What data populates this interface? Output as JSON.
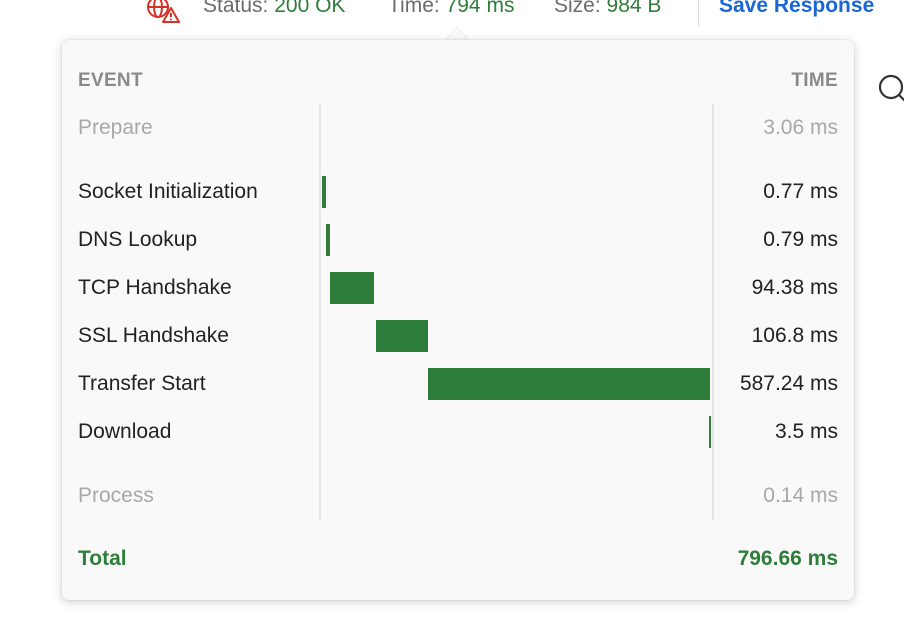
{
  "topbar": {
    "status_label": "Status:",
    "status_value": "200 OK",
    "time_label": "Time:",
    "time_value": "794 ms",
    "size_label": "Size:",
    "size_value": "984 B",
    "save_label": "Save Response",
    "network_icon": "globe-warning-icon",
    "search_icon": "search-icon"
  },
  "timing": {
    "header_event": "EVENT",
    "header_time": "TIME",
    "prepare": {
      "label": "Prepare",
      "value": "3.06 ms"
    },
    "events": [
      {
        "label": "Socket Initialization",
        "value": "0.77 ms",
        "ms": 0.77
      },
      {
        "label": "DNS Lookup",
        "value": "0.79 ms",
        "ms": 0.79
      },
      {
        "label": "TCP Handshake",
        "value": "94.38 ms",
        "ms": 94.38
      },
      {
        "label": "SSL Handshake",
        "value": "106.8 ms",
        "ms": 106.8
      },
      {
        "label": "Transfer Start",
        "value": "587.24 ms",
        "ms": 587.24
      },
      {
        "label": "Download",
        "value": "3.5 ms",
        "ms": 3.5
      }
    ],
    "process": {
      "label": "Process",
      "value": "0.14 ms"
    },
    "total_label": "Total",
    "total_value": "796.66 ms"
  },
  "colors": {
    "success": "#2f7d3a",
    "accent": "#1a66d6",
    "error": "#d93025"
  }
}
